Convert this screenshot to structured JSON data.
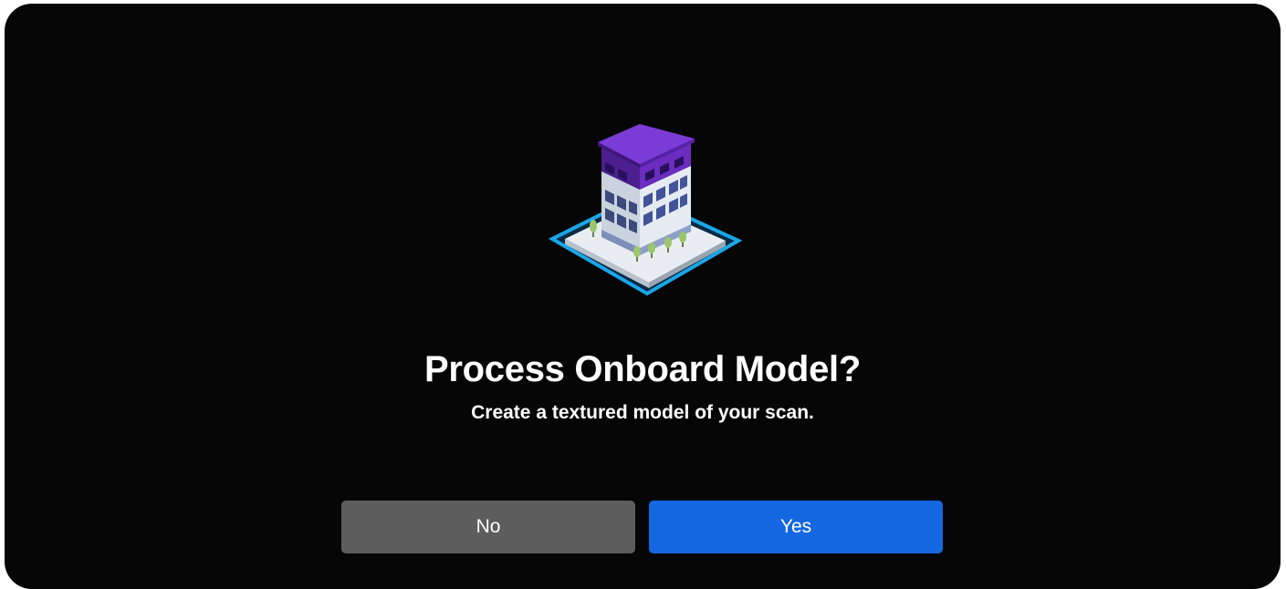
{
  "dialog": {
    "illustration_icon": "building-scan-icon",
    "title": "Process Onboard Model?",
    "subtitle": "Create a textured model of your scan.",
    "no_label": "No",
    "yes_label": "Yes"
  },
  "colors": {
    "background": "#060606",
    "no_button": "#5d5d5d",
    "yes_button": "#1467e0",
    "text": "#ffffff",
    "roof": "#6a2dbf",
    "platform": "#1aa6e8"
  }
}
